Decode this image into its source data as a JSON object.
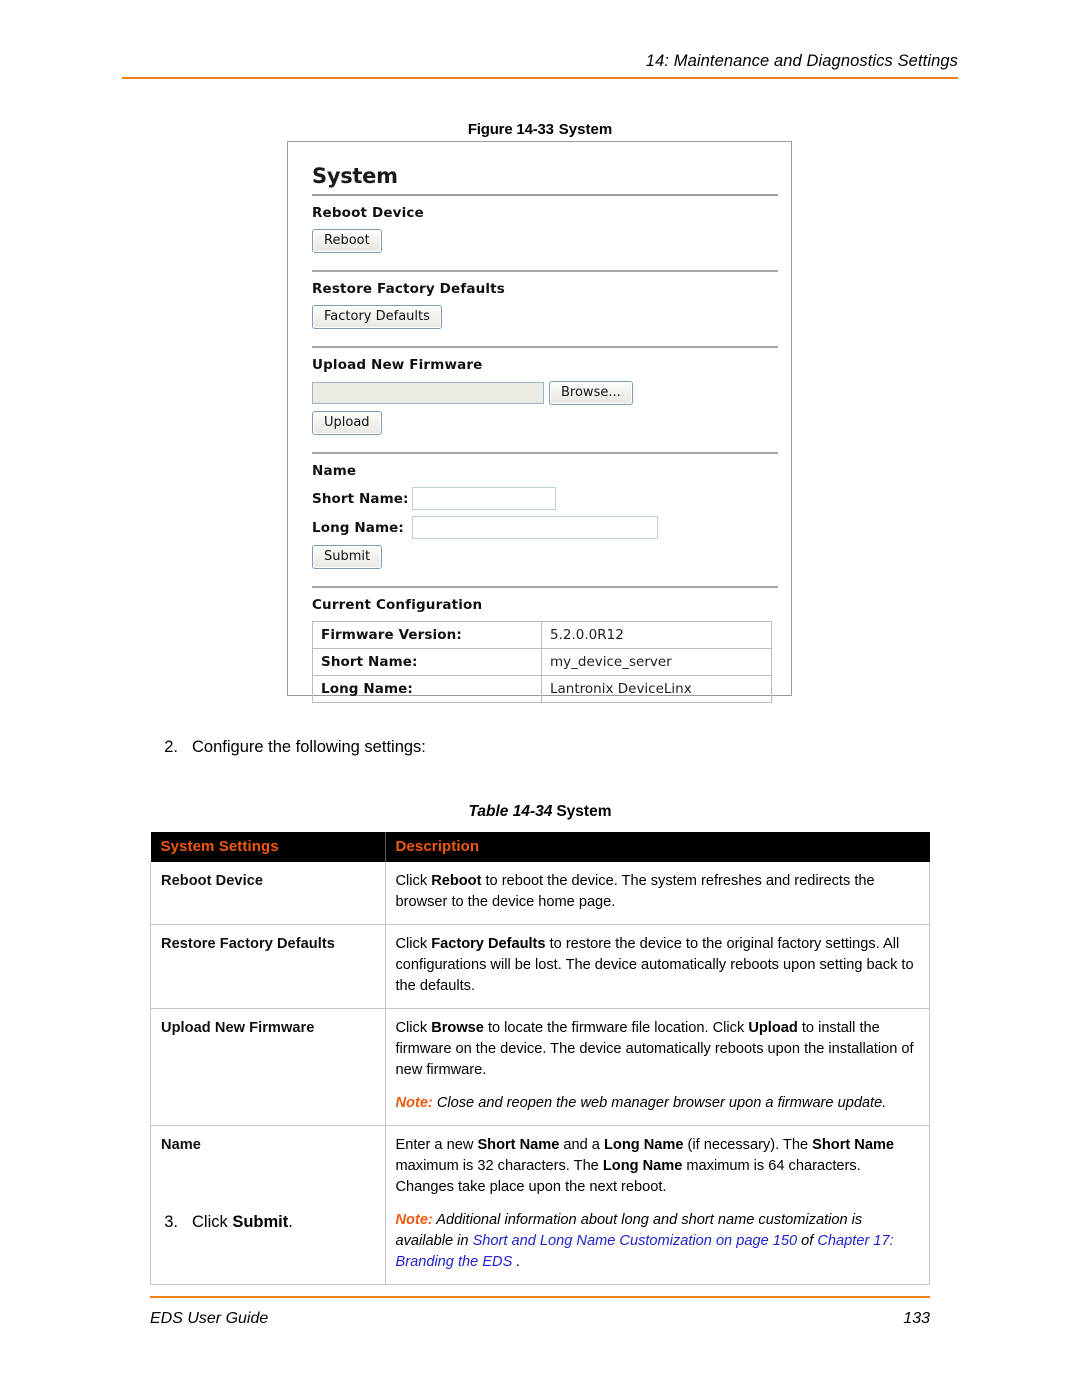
{
  "header": {
    "running_title": "14: Maintenance and Diagnostics Settings",
    "rule_color": "#F0821E"
  },
  "figure": {
    "caption_number": "Figure 14-33",
    "caption_title": "System",
    "screenshot": {
      "title": "System",
      "sections": [
        {
          "heading": "Reboot Device",
          "button": "Reboot"
        },
        {
          "heading": "Restore Factory Defaults",
          "button": "Factory Defaults"
        },
        {
          "heading": "Upload New Firmware",
          "browse_button": "Browse...",
          "file_value": "",
          "upload_button": "Upload"
        },
        {
          "heading": "Name",
          "short_name_label": "Short Name:",
          "short_name_value": "",
          "long_name_label": "Long Name:",
          "long_name_value": "",
          "submit_button": "Submit"
        },
        {
          "heading": "Current Configuration"
        }
      ],
      "current_configuration": [
        {
          "key": "Firmware Version:",
          "value": "5.2.0.0R12"
        },
        {
          "key": "Short Name:",
          "value": "my_device_server"
        },
        {
          "key": "Long Name:",
          "value": "Lantronix DeviceLinx"
        }
      ]
    }
  },
  "steps": {
    "step2_num": "2.",
    "step2_text": "Configure the following settings:",
    "step3_num": "3.",
    "step3_text_pre": "Click ",
    "step3_text_bold": "Submit",
    "step3_text_post": "."
  },
  "table": {
    "caption_number": "Table 14-34",
    "caption_title": "System",
    "header_bg": "#000000",
    "header_color": "#F0590B",
    "columns": [
      "System Settings",
      "Description"
    ],
    "rows": [
      {
        "setting": "Reboot Device",
        "desc_1a": "Click ",
        "desc_1b": "Reboot",
        "desc_1c": " to reboot the device. The system refreshes and redirects the browser to the device home page."
      },
      {
        "setting": "Restore Factory Defaults",
        "desc_1a": "Click ",
        "desc_1b": "Factory Defaults",
        "desc_1c": " to restore the device to the original factory settings. All configurations will be lost. The device automatically reboots upon setting back to the defaults."
      },
      {
        "setting": "Upload New Firmware",
        "desc_1a": "Click ",
        "desc_1b": "Browse",
        "desc_1c": " to locate the firmware file location. Click ",
        "desc_1d": "Upload",
        "desc_1e": " to install the firmware on the device. The device automatically reboots upon the installation of new firmware.",
        "note_lead": "Note:",
        "note_body": " Close and reopen the web manager browser upon a firmware update."
      },
      {
        "setting": "Name",
        "desc_1a": "Enter a new ",
        "desc_1b": "Short Name",
        "desc_1c": " and a ",
        "desc_1d": "Long Name",
        "desc_1e": " (if necessary). The ",
        "desc_1f": "Short Name",
        "desc_1g": " maximum is 32 characters. The ",
        "desc_1h": "Long Name",
        "desc_1i": " maximum is 64 characters. Changes take place upon the next reboot.",
        "note_lead": "Note:",
        "note_body_a": " Additional information about long and short name customization is available in ",
        "note_link_1": "Short and Long Name Customization on page 150",
        "note_body_b": " of ",
        "note_link_2": "Chapter 17: Branding the EDS",
        "note_body_c": " ."
      }
    ]
  },
  "footer": {
    "guide_title": "EDS User Guide",
    "page_number": "133",
    "rule_color": "#F0821E"
  }
}
